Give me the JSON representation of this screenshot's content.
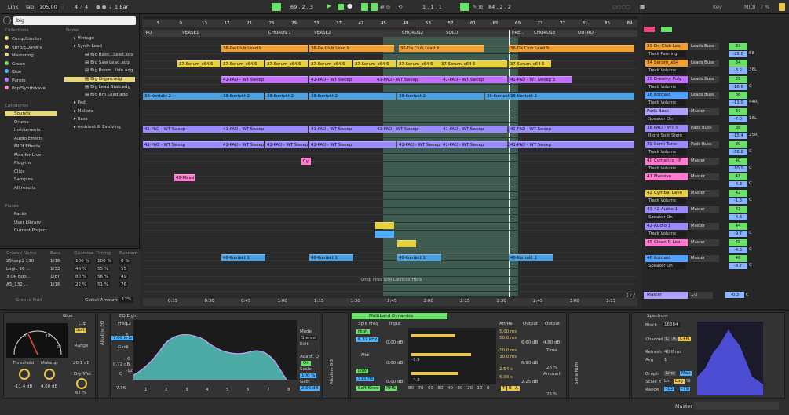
{
  "transport": {
    "link": "Link",
    "tap": "Tap",
    "tempo": "105.00",
    "sig_num": "4",
    "sig_den": "4",
    "quant": "1 Bar",
    "pos": "69 . 2 . 3",
    "loop_start": "1 . 1 . 1",
    "loop_len": "84 . 2 . 2",
    "key": "Key",
    "midi": "MIDI",
    "cpu": "7 %",
    "dots": "○○○○"
  },
  "browser": {
    "search": "big",
    "name_header": "Name",
    "collections_header": "Collections",
    "collections": [
      "Comp/Limiter",
      "Strip/EQ/Pre's",
      "Mastering",
      "Green",
      "Blue",
      "Purple",
      "Pop/Synthwave"
    ],
    "categories_header": "Categories",
    "categories": [
      "Sounds",
      "Drums",
      "Instruments",
      "Audio Effects",
      "MIDI Effects",
      "Max for Live",
      "Plug-ins",
      "Clips",
      "Samples",
      "All results"
    ],
    "places_header": "Places",
    "places": [
      "Packs",
      "User Library",
      "Current Project"
    ],
    "files": [
      "Vintage",
      "Synth Lead",
      "Big Bass...Lead.adg",
      "Big Saw Lead.adg",
      "Big Room...lide.adg",
      "Big Organ.adg",
      "Big Lead Stab.adg",
      "Big Bro Lead.adg",
      "Pad",
      "Mallets",
      "Bass",
      "Ambient & Evolving"
    ]
  },
  "groove": {
    "headers": [
      "Groove Name",
      "Base",
      "Quantize",
      "Timing",
      "Random"
    ],
    "rows": [
      [
        "25tsep1 130",
        "1/16",
        "100 %",
        "100 %",
        "0 %"
      ],
      [
        "Logic 16 ...",
        "1/32",
        "46 %",
        "55 %",
        "55"
      ],
      [
        "3 OP Boo...",
        "1/8T",
        "80 %",
        "56 %",
        "49"
      ],
      [
        "A5_132 ...",
        "1/16",
        "22 %",
        "51 %",
        "76"
      ]
    ],
    "pool": "Groove Pool",
    "global_label": "Global Amount",
    "global": "12%"
  },
  "ruler": [
    "5",
    "9",
    "13",
    "17",
    "21",
    "25",
    "29",
    "33",
    "37",
    "41",
    "45",
    "49",
    "53",
    "57",
    "61",
    "65",
    "69",
    "73",
    "77",
    "81",
    "85",
    "89"
  ],
  "sections": [
    "TRO",
    "VERSE1",
    "CHORUS 1",
    "VERSE2",
    "CHORUS2",
    "SOLO",
    "PRE...",
    "CHORUS3",
    "OUTRO"
  ],
  "time": [
    "0:15",
    "0:30",
    "0:45",
    "1:00",
    "1:15",
    "1:30",
    "1:45",
    "2:00",
    "2:15",
    "2:30",
    "2:45",
    "3:00",
    "3:15"
  ],
  "clips": {
    "lead": "36-Da Club Lead 9",
    "serum": "37-Serum_x64 5",
    "sweep": "41-PAD - WT Sweep",
    "sweep3": "41-PAD - WT Sweep 3",
    "kontakt": "38-Kontakt 2",
    "kontakt46": "46-Kontakt 1",
    "massive": "48-Massiv",
    "cy": "Cy",
    "drop": "Drop Files and Devices Here",
    "page": "1/2"
  },
  "mixer": [
    {
      "name": "33 Da Club Lea",
      "sub": "Track Panning",
      "route": "Leads Buss",
      "num": "33",
      "v1": "-28.0",
      "v2": "58",
      "c": "#f0a030"
    },
    {
      "name": "34 Serum_x64",
      "sub": "Track Volume",
      "route": "Leads Buss",
      "num": "34",
      "v1": "-3.2",
      "v2": "36L",
      "c": "#f0a030"
    },
    {
      "name": "35 Dreamy Poly",
      "sub": "Track Volume",
      "route": "Leads Buss",
      "num": "35",
      "v1": "-16.6",
      "v2": "C",
      "c": "#c070ff"
    },
    {
      "name": "36 Kontakt",
      "sub": "Track Volume",
      "route": "Leads Buss",
      "num": "36",
      "v1": "-11.0",
      "v2": "44R",
      "c": "#50a0ff"
    },
    {
      "name": "Pads Buss",
      "sub": "Speaker On",
      "route": "Master",
      "num": "37",
      "v1": "-7.0",
      "v2": "16L",
      "c": "#b0a0ff"
    },
    {
      "name": "38 PAD - WT S",
      "sub": "Right Split Stere",
      "route": "Pads Buss",
      "num": "38",
      "v1": "-15.4",
      "v2": "25R",
      "c": "#9a8cff"
    },
    {
      "name": "39 Semi Tune",
      "sub": "Track Volume",
      "route": "Pads Buss",
      "num": "39",
      "v1": "-36.8",
      "v2": "C",
      "c": "#9a8cff"
    },
    {
      "name": "40 Cymatics - P",
      "sub": "Track Volume",
      "route": "Master",
      "num": "40",
      "v1": "-10.0",
      "v2": "C",
      "c": "#ff7ad0"
    },
    {
      "name": "41 Massive",
      "sub": "",
      "route": "Master",
      "num": "41",
      "v1": "-4.3",
      "v2": "C",
      "c": "#ff7ad0"
    },
    {
      "name": "42 Cymbal Laye",
      "sub": "Track Volume",
      "route": "Master",
      "num": "42",
      "v1": "-1.3",
      "v2": "C",
      "c": "#e6d040"
    },
    {
      "name": "43 42-Audio 1",
      "sub": "Speaker On",
      "route": "Master",
      "num": "43",
      "v1": "-4.6",
      "v2": "",
      "c": "#9a8cff"
    },
    {
      "name": "42-Audio 1",
      "sub": "Track Volume",
      "route": "Master",
      "num": "44",
      "v1": "-9.7",
      "v2": "C",
      "c": "#9a8cff"
    },
    {
      "name": "45 Clean N Lea",
      "sub": "",
      "route": "Master",
      "num": "45",
      "v1": "-4.3",
      "v2": "C",
      "c": "#ff7ad0"
    },
    {
      "name": "46 Kontakt",
      "sub": "Speaker On",
      "route": "Master",
      "num": "46",
      "v1": "-8.7",
      "v2": "C",
      "c": "#50a0ff"
    }
  ],
  "master": {
    "name": "Master",
    "route": "1/2",
    "vol": "-0.3",
    "pan": "C"
  },
  "devices": {
    "glue": {
      "title": "Glue",
      "threshold_l": "Threshold",
      "threshold": "-11.4 dB",
      "makeup_l": "Makeup",
      "makeup": "4.60 dB",
      "clip": "Clip",
      "soft": "Soft",
      "range_l": "Range",
      "range": "20.1 dB",
      "drywet_l": "Dry/Wet",
      "drywet": "67 %"
    },
    "eq": {
      "title": "EQ Eight",
      "freq_l": "Freq",
      "freq": "7.06 kHz",
      "gain_l": "Gain",
      "gain": "0.72 dB",
      "q_l": "Q",
      "q": "7.96",
      "mode_l": "Mode",
      "mode": "Stereo",
      "edit": "Edit",
      "adapt": "Adapt. Q",
      "on": "On",
      "scale_l": "Scale",
      "scale": "100 %",
      "gain2_l": "Gain",
      "gain2": "2.06 dB",
      "bands": [
        "1",
        "2",
        "3",
        "4",
        "5",
        "6",
        "7",
        "8"
      ],
      "yt": [
        "12",
        "6",
        "0",
        "-6",
        "-12"
      ]
    },
    "mb": {
      "title": "Multiband Dynamics",
      "split": "Split Freq",
      "high": "High",
      "hf": "6.37 kHz",
      "mid": "Mid",
      "low": "Low",
      "lf": "515 Hz",
      "input_l": "Input",
      "in1": "0.00 dB",
      "in2": "0.00 dB",
      "in3": "0.00 dB",
      "atrel": "Att/Rel",
      "a1": "5.00 ms",
      "r1": "50.0 ms",
      "a2": "10.0 ms",
      "r2": "30.0 ms",
      "a3": "2.54 s",
      "r3": "5.00 s",
      "output_l": "Output",
      "o1": "6.60 dB",
      "o2": "6.90 dB",
      "o3": "2.25 dB",
      "ol": "Output",
      "ov": "4.80 dB",
      "time_l": "Time",
      "time": "26 %",
      "amount_l": "Amount",
      "amount": "26 %",
      "meter1": "-7.9",
      "meter2": "-4.8",
      "softknee": "Soft Knee",
      "rms": "RMS",
      "scale": [
        "80",
        "70",
        "60",
        "50",
        "40",
        "30",
        "20",
        "10",
        "0"
      ],
      "tbf": [
        "T",
        "B",
        "A"
      ]
    },
    "spec": {
      "title": "Spectrum",
      "block_l": "Block",
      "block": "16384",
      "channel_l": "Channel",
      "L": "L",
      "R": "R",
      "LR": "L+R",
      "refresh_l": "Refresh",
      "refresh": "40.0 ms",
      "avg_l": "Avg",
      "avg": "1",
      "graph_l": "Graph",
      "line": "Line",
      "max": "Max",
      "scalex_l": "Scale X",
      "lin": "Lin",
      "log": "Log",
      "st": "St",
      "range_l": "Range",
      "r1": "-13",
      "r2": "-79"
    },
    "sidebar": [
      "Alkaline EQ",
      "Alkaline GG",
      "SerialNum"
    ]
  },
  "status": {
    "master": "Master"
  }
}
